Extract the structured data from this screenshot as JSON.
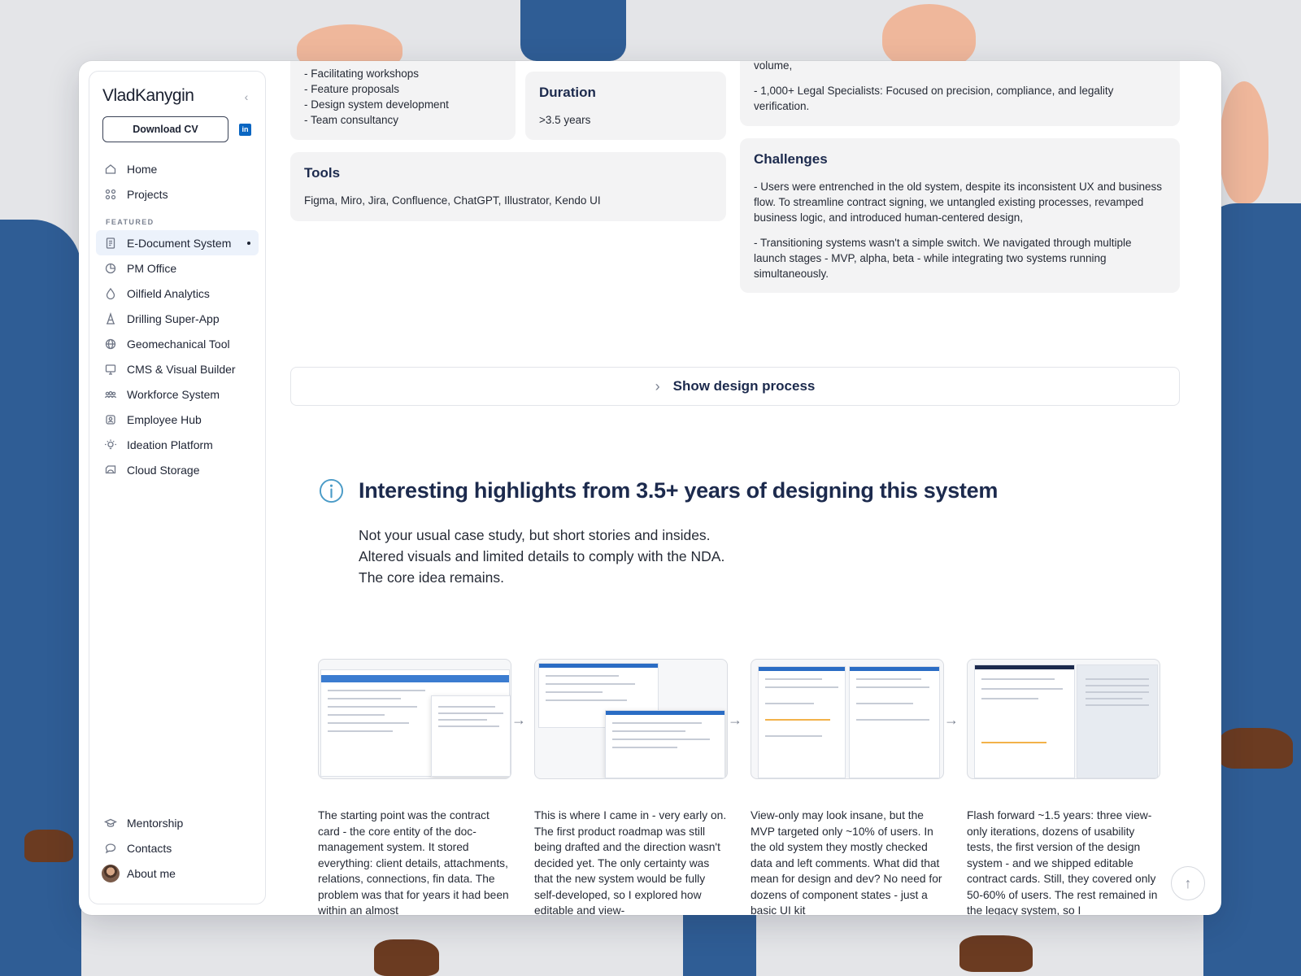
{
  "sidebar": {
    "brand": "VladKanygin",
    "download_cv": "Download CV",
    "linkedin": "in",
    "nav_main": [
      {
        "label": "Home",
        "icon": "home-icon"
      },
      {
        "label": "Projects",
        "icon": "grid-icon"
      }
    ],
    "featured_label": "FEATURED",
    "featured": [
      {
        "label": "E-Document System",
        "icon": "document-icon",
        "active": true
      },
      {
        "label": "PM Office",
        "icon": "pie-chart-icon"
      },
      {
        "label": "Oilfield Analytics",
        "icon": "drop-icon"
      },
      {
        "label": "Drilling Super-App",
        "icon": "rig-icon"
      },
      {
        "label": "Geomechanical Tool",
        "icon": "globe-icon"
      },
      {
        "label": "CMS & Visual Builder",
        "icon": "monitor-icon"
      },
      {
        "label": "Workforce System",
        "icon": "people-icon"
      },
      {
        "label": "Employee Hub",
        "icon": "hub-icon"
      },
      {
        "label": "Ideation Platform",
        "icon": "bulb-icon"
      },
      {
        "label": "Cloud Storage",
        "icon": "cloud-icon"
      }
    ],
    "nav_bottom": [
      {
        "label": "Mentorship",
        "icon": "graduation-cap-icon"
      },
      {
        "label": "Contacts",
        "icon": "chat-bubble-icon"
      },
      {
        "label": "About me",
        "icon": "avatar"
      }
    ]
  },
  "cards": {
    "activities": [
      "- Facilitating workshops",
      "- Feature proposals",
      "- Design system development",
      "- Team consultancy"
    ],
    "duration_title": "Duration",
    "duration_value": ">3.5 years",
    "tools_title": "Tools",
    "tools_value": "Figma, Miro, Jira, Confluence, ChatGPT, Illustrator, Kendo UI",
    "users_tail": "volume,",
    "users_legal": "- 1,000+ Legal Specialists: Focused on precision, compliance, and legality verification.",
    "challenges_title": "Challenges",
    "challenges_1": "- Users were entrenched in the old system, despite its inconsistent UX and business flow. To streamline contract signing, we untangled existing processes, revamped business logic, and introduced human-centered design,",
    "challenges_2": "- Transitioning systems wasn't a simple switch. We navigated through multiple launch stages - MVP, alpha, beta - while integrating two systems running simultaneously."
  },
  "show_process": "Show design process",
  "highlights": {
    "title": "Interesting highlights from 3.5+ years of designing this system",
    "line1": "Not your usual case study, but short stories and insides.",
    "line2": "Altered visuals and limited details to comply with the NDA.",
    "line3": "The core idea remains."
  },
  "stories": [
    "The starting point was the contract card - the core entity of the doc-management system. It stored everything: client details, attachments, relations, connections, fin data. The problem was that for years it had been within an almost",
    "This is where I came in - very early on. The first product roadmap was still being drafted and the direction wasn't decided yet. The only certainty was that the new system would be fully self-developed, so I explored how editable and view-",
    "View-only may look insane, but the MVP targeted only ~10% of users. In the old system they mostly checked data and left comments. What did that mean for design and dev? No need for dozens of component states - just a basic UI kit",
    "Flash forward ~1.5 years: three view-only iterations, dozens of usability tests, the first version of the design system - and we shipped editable contract cards. Still, they covered only 50-60% of users. The rest remained in the legacy system, so I"
  ],
  "colors": {
    "accent": "#1c2a4d",
    "active_bg": "#ecf2fb",
    "linkedin": "#0a66c2",
    "info": "#4a9bc7"
  }
}
